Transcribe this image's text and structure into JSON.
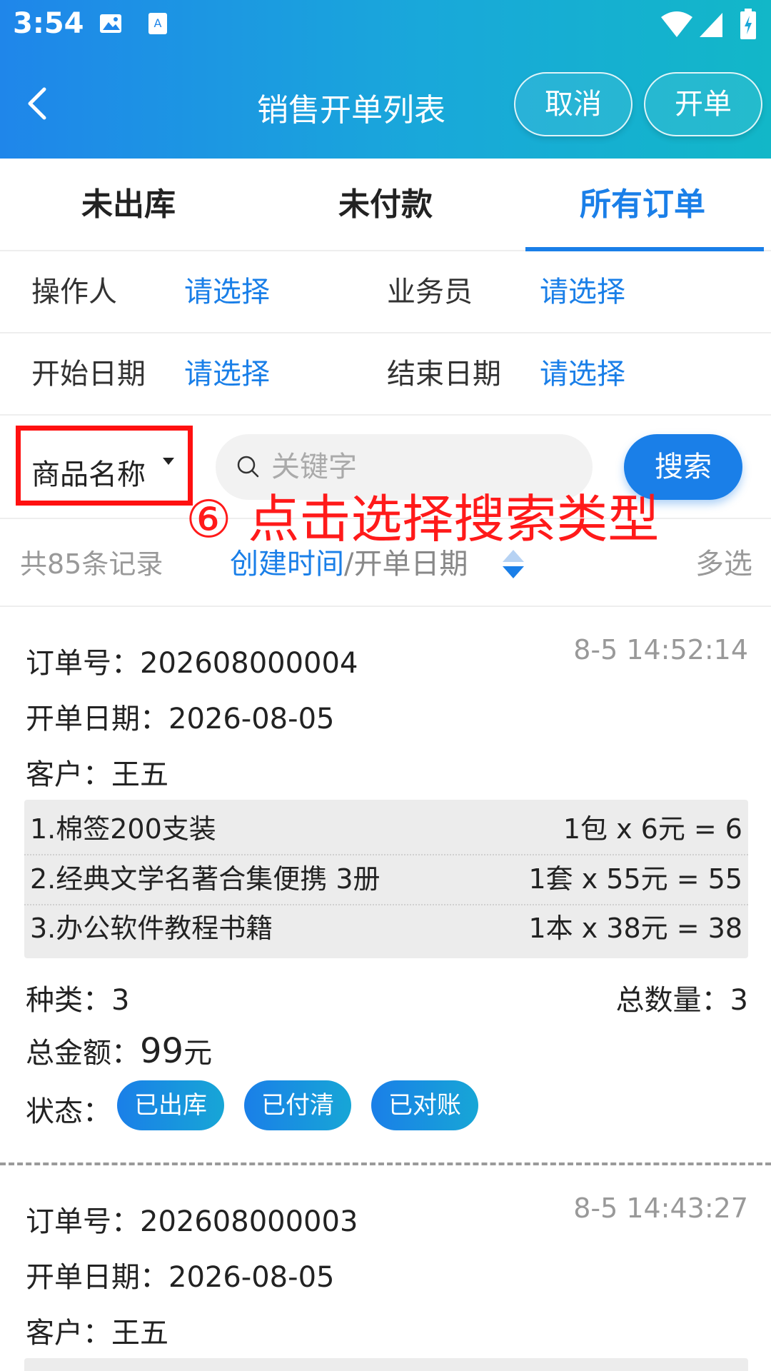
{
  "status_bar": {
    "time": "3:54"
  },
  "header": {
    "title": "销售开单列表",
    "cancel_label": "取消",
    "create_label": "开单"
  },
  "tabs": [
    {
      "label": "未出库",
      "active": false
    },
    {
      "label": "未付款",
      "active": false
    },
    {
      "label": "所有订单",
      "active": true
    }
  ],
  "filters": {
    "operator_label": "操作人",
    "operator_value": "请选择",
    "salesperson_label": "业务员",
    "salesperson_value": "请选择",
    "start_date_label": "开始日期",
    "start_date_value": "请选择",
    "end_date_label": "结束日期",
    "end_date_value": "请选择"
  },
  "search": {
    "type_label": "商品名称",
    "placeholder": "关键字",
    "button_label": "搜索",
    "annotation": "⑥ 点击选择搜索类型"
  },
  "list_bar": {
    "record_count": "共85条记录",
    "sort_active": "创建时间",
    "sort_separator": "/",
    "sort_other": "开单日期",
    "multi_select": "多选"
  },
  "orders": [
    {
      "order_no_label": "订单号：",
      "order_no": "202608000004",
      "time": "8-5 14:52:14",
      "date_label": "开单日期：",
      "date": "2026-08-05",
      "customer_label": "客户：",
      "customer": "王五",
      "items": [
        {
          "name": "1.棉签200支装",
          "qty": "1包 x 6元 = 6"
        },
        {
          "name": "2.经典文学名著合集便携 3册",
          "qty": "1套 x 55元 = 55"
        },
        {
          "name": "3.办公软件教程书籍",
          "qty": "1本 x 38元 = 38"
        }
      ],
      "kinds_label": "种类：",
      "kinds": "3",
      "total_qty_label": "总数量：",
      "total_qty": "3",
      "total_amount_label": "总金额：",
      "total_amount": "99",
      "currency": "元",
      "status_label": "状态：",
      "statuses": [
        "已出库",
        "已付清",
        "已对账"
      ]
    },
    {
      "order_no_label": "订单号：",
      "order_no": "202608000003",
      "time": "8-5 14:43:27",
      "date_label": "开单日期：",
      "date": "2026-08-05",
      "customer_label": "客户：",
      "customer": "王五"
    }
  ],
  "colors": {
    "accent": "#1a7fe8",
    "annotation": "#ff1a1a",
    "header_start": "#1f86ea",
    "header_end": "#12b7c8"
  }
}
